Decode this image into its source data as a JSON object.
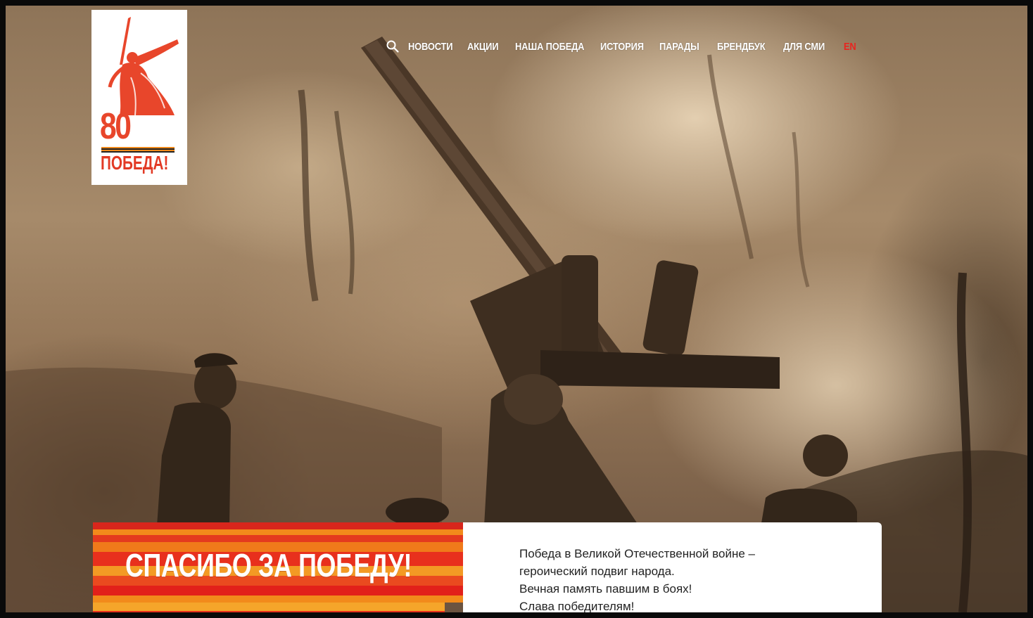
{
  "brand": {
    "logo_number": "80",
    "logo_word": "ПОБЕДА!",
    "logo_name": "mother-motherland-statue"
  },
  "nav": {
    "search_icon": "search-icon",
    "items": [
      "НОВОСТИ",
      "АКЦИИ",
      "НАША ПОБЕДА",
      "ИСТОРИЯ",
      "ПАРАДЫ",
      "БРЕНДБУК",
      "ДЛЯ СМИ"
    ],
    "lang": "EN"
  },
  "hero": {
    "image": "sepia-ww2-artillery-crew-photo"
  },
  "banner": {
    "title": "СПАСИБО ЗА ПОБЕДУ!",
    "lines": [
      "Победа в Великой Отечественной войне –",
      "героический подвиг народа.",
      "Вечная память павшим в боях!",
      "Слава победителям!"
    ]
  },
  "colors": {
    "accent_red": "#e8251f",
    "accent_orange": "#f0891c",
    "sepia": "#a68a6a"
  }
}
